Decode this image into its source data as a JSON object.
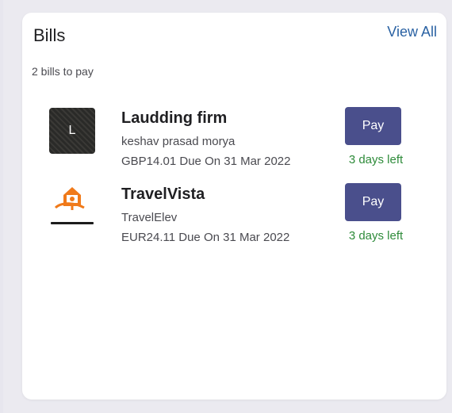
{
  "bills_widget": {
    "title": "Bills",
    "view_all_label": "View All",
    "summary": "2 bills to pay",
    "items": [
      {
        "logo_letter": "L",
        "logo_icon": "letter-avatar",
        "name": "Laudding firm",
        "payee": "keshav prasad morya",
        "due": "GBP14.01 Due On 31 Mar 2022",
        "pay_label": "Pay",
        "days_left": "3 days left"
      },
      {
        "logo_icon": "house-plug-icon",
        "name": "TravelVista",
        "payee": "TravelElev",
        "due": "EUR24.11 Due On 31 Mar 2022",
        "pay_label": "Pay",
        "days_left": "3 days left"
      }
    ]
  },
  "colors": {
    "accent": "#4a4f8c",
    "link": "#2a62a3",
    "success": "#2e8b3a",
    "travel_logo": "#f07a1a"
  }
}
